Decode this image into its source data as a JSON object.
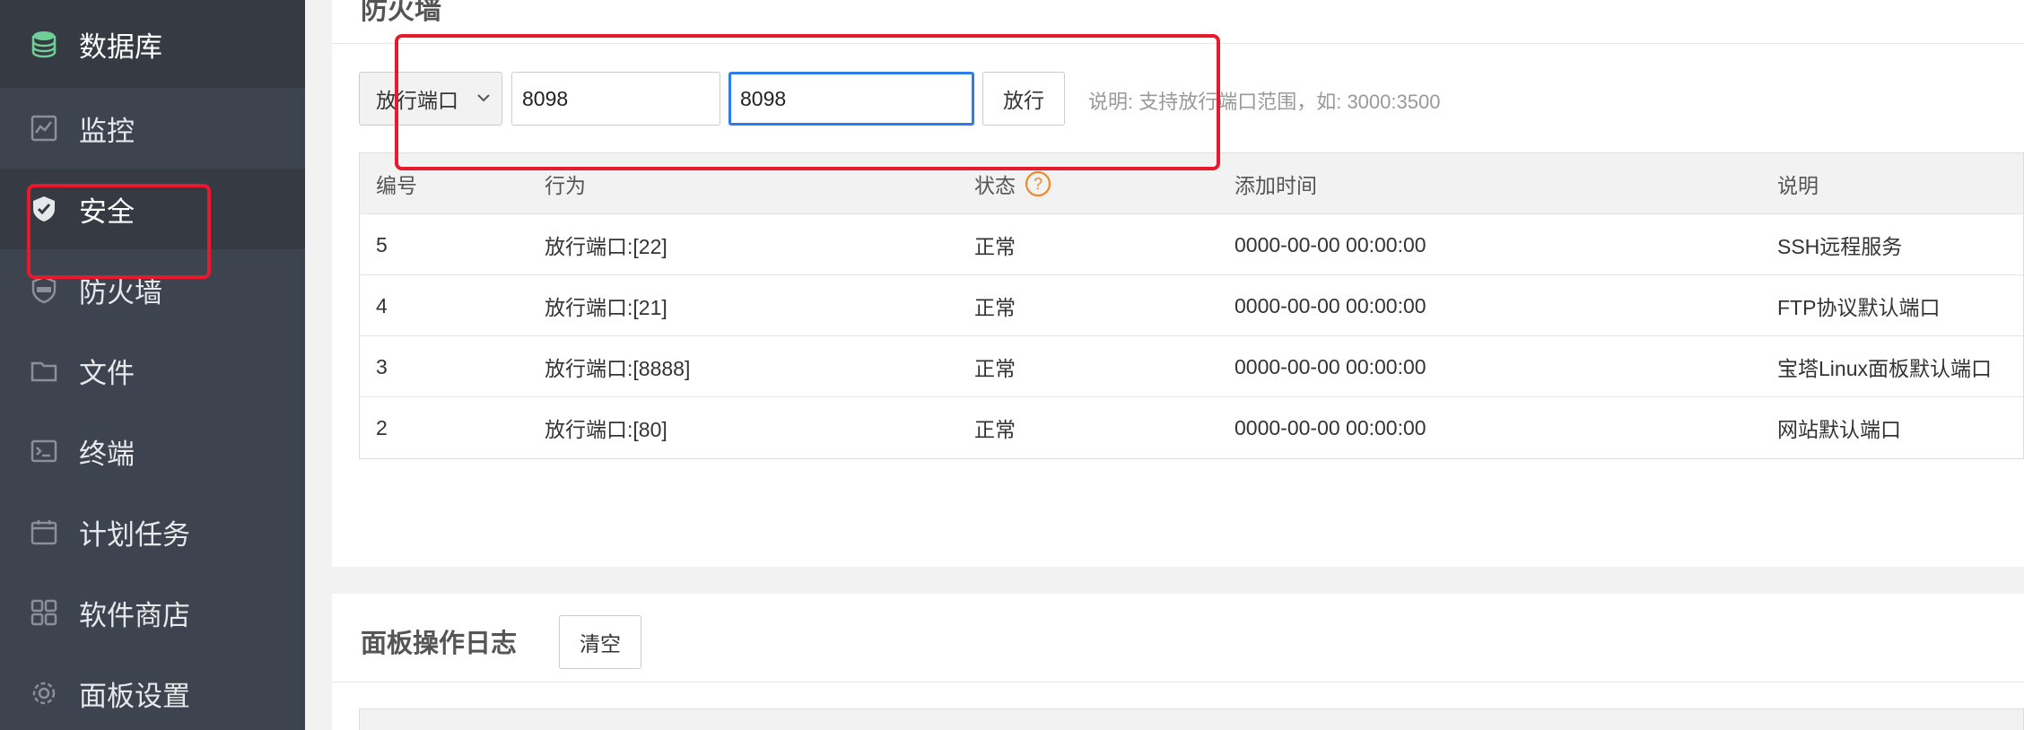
{
  "sidebar": {
    "items": [
      {
        "label": "数据库",
        "icon": "database-icon"
      },
      {
        "label": "监控",
        "icon": "monitor-icon"
      },
      {
        "label": "安全",
        "icon": "shield-check-icon"
      },
      {
        "label": "防火墙",
        "icon": "waf-shield-icon"
      },
      {
        "label": "文件",
        "icon": "folder-icon"
      },
      {
        "label": "终端",
        "icon": "terminal-icon"
      },
      {
        "label": "计划任务",
        "icon": "calendar-icon"
      },
      {
        "label": "软件商店",
        "icon": "grid-apps-icon"
      },
      {
        "label": "面板设置",
        "icon": "gear-icon"
      }
    ]
  },
  "firewall": {
    "title": "防火墙",
    "action_select": "放行端口",
    "port_start": "8098",
    "port_end": "8098",
    "allow_button": "放行",
    "hint": "说明: 支持放行端口范围，如: 3000:3500",
    "table": {
      "headers": [
        "编号",
        "行为",
        "状态",
        "添加时间",
        "说明"
      ],
      "rows": [
        {
          "id": "5",
          "action": "放行端口:[22]",
          "status": "正常",
          "time": "0000-00-00 00:00:00",
          "note": "SSH远程服务"
        },
        {
          "id": "4",
          "action": "放行端口:[21]",
          "status": "正常",
          "time": "0000-00-00 00:00:00",
          "note": "FTP协议默认端口"
        },
        {
          "id": "3",
          "action": "放行端口:[8888]",
          "status": "正常",
          "time": "0000-00-00 00:00:00",
          "note": "宝塔Linux面板默认端口"
        },
        {
          "id": "2",
          "action": "放行端口:[80]",
          "status": "正常",
          "time": "0000-00-00 00:00:00",
          "note": "网站默认端口"
        }
      ]
    }
  },
  "log": {
    "title": "面板操作日志",
    "clear_button": "清空"
  },
  "colors": {
    "sidebar_bg": "#3e444f",
    "sidebar_active_bg": "#353a43",
    "focus_border": "#2b7de9",
    "annotation_red": "#e8192c",
    "help_orange": "#f0892a"
  }
}
